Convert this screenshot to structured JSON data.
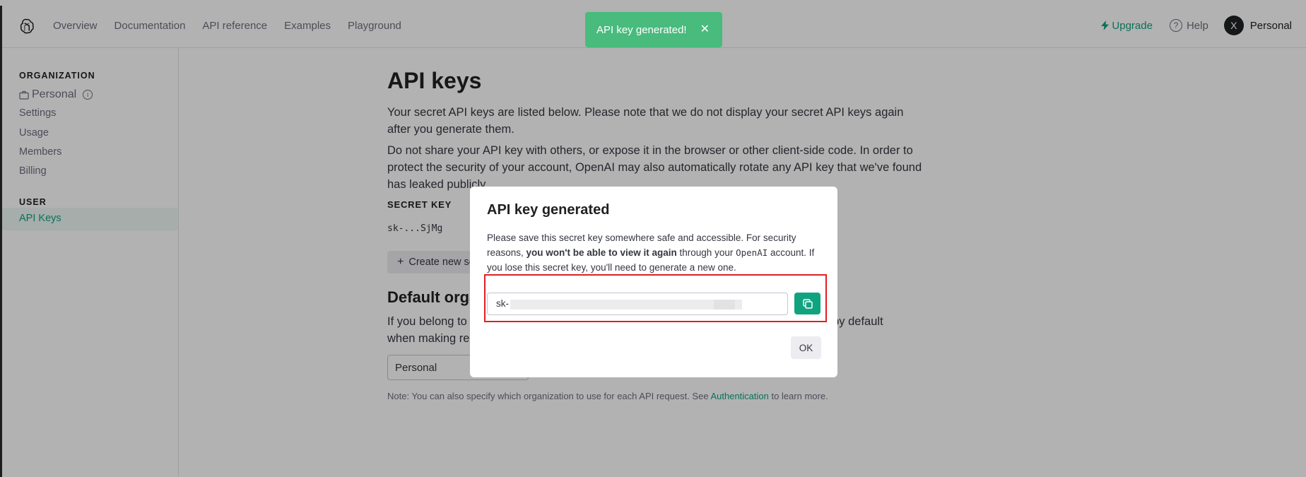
{
  "header": {
    "nav": [
      "Overview",
      "Documentation",
      "API reference",
      "Examples",
      "Playground"
    ],
    "upgrade": "Upgrade",
    "help": "Help",
    "help_glyph": "?",
    "avatar_initial": "X",
    "account": "Personal"
  },
  "sidebar": {
    "org_heading": "ORGANIZATION",
    "org_name": "Personal",
    "info_glyph": "i",
    "items": [
      "Settings",
      "Usage",
      "Members",
      "Billing"
    ],
    "user_heading": "USER",
    "active_item": "API Keys"
  },
  "main": {
    "title": "API keys",
    "p1": "Your secret API keys are listed below. Please note that we do not display your secret API keys again after you generate them.",
    "p2": "Do not share your API key with others, or expose it in the browser or other client-side code. In order to protect the security of your account, OpenAI may also automatically rotate any API key that we've found has leaked publicly.",
    "secret_key_label": "SECRET KEY",
    "masked_key": "sk-...SjMg",
    "create_button": "Create new secret key",
    "default_org_title": "Default organization",
    "p3": "If you belong to multiple organizations, this setting controls which organization is used by default when making requests with the API keys above.",
    "select_value": "Personal",
    "note_prefix": "Note: You can also specify which organization to use for each API request. See ",
    "note_link": "Authentication",
    "note_suffix": " to learn more."
  },
  "toast": {
    "text": "API key generated!",
    "close": "✕"
  },
  "modal": {
    "title": "API key generated",
    "text_a": "Please save this secret key somewhere safe and accessible. For security reasons, ",
    "text_bold": "you won't be able to view it again",
    "text_b": " through your ",
    "text_mono": "OpenAI",
    "text_c": " account. If you lose this secret key, you'll need to generate a new one.",
    "key_prefix": "sk-",
    "ok": "OK"
  },
  "colors": {
    "accent": "#10a37f",
    "toast": "#48bb7d",
    "highlight": "#e02020"
  }
}
